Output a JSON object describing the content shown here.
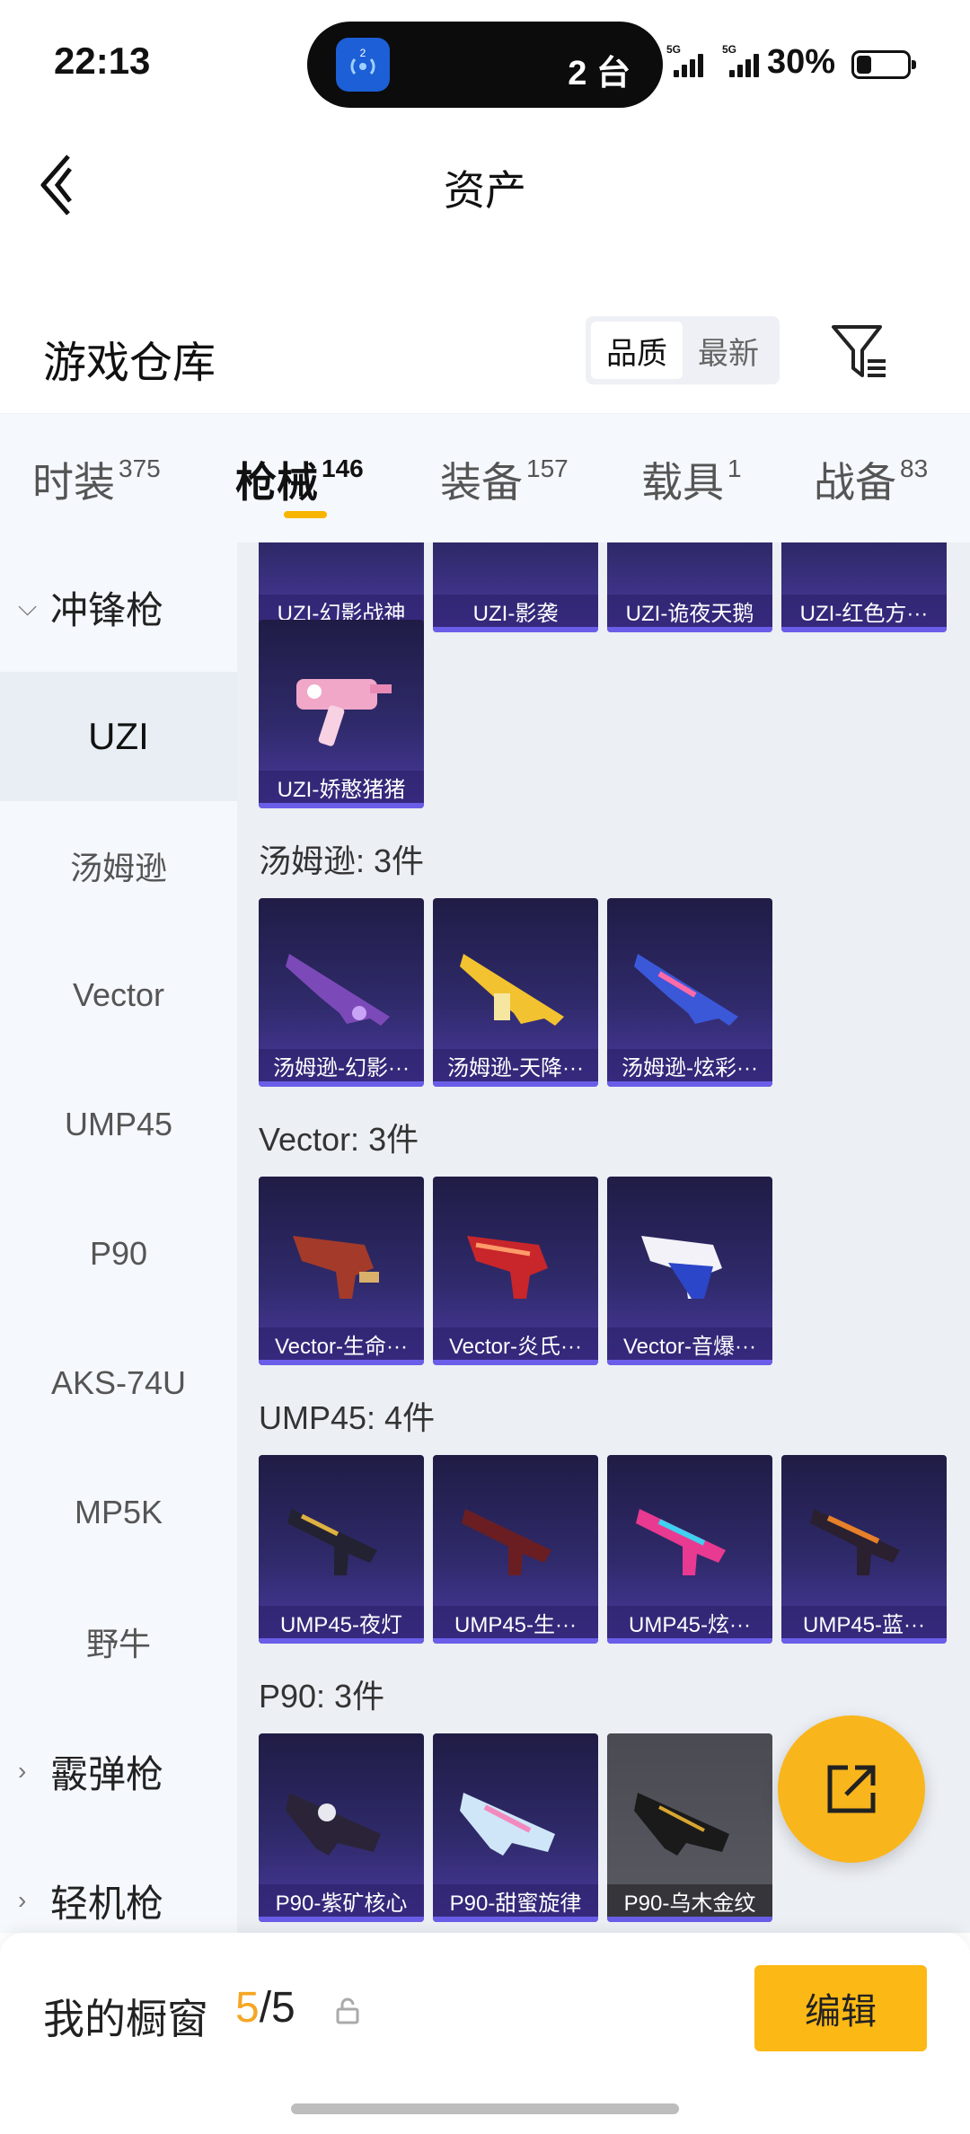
{
  "status_bar": {
    "time": "22:13",
    "island_badge": "2",
    "island_count": "2 台",
    "network1": "5G",
    "network2": "5G",
    "battery": "30%",
    "battery_level": 0.3
  },
  "nav": {
    "title": "资产"
  },
  "repo": {
    "title": "游戏仓库",
    "sort": [
      "品质",
      "最新"
    ],
    "sort_active": "品质"
  },
  "tabs": [
    {
      "label": "时装",
      "count": "375"
    },
    {
      "label": "枪械",
      "count": "146"
    },
    {
      "label": "装备",
      "count": "157"
    },
    {
      "label": "载具",
      "count": "1"
    },
    {
      "label": "战备",
      "count": "83"
    }
  ],
  "sidebar": [
    {
      "label": "冲锋枪",
      "type": "category",
      "expanded": true
    },
    {
      "label": "UZI",
      "type": "item",
      "selected": true
    },
    {
      "label": "汤姆逊",
      "type": "item"
    },
    {
      "label": "Vector",
      "type": "item"
    },
    {
      "label": "UMP45",
      "type": "item"
    },
    {
      "label": "P90",
      "type": "item"
    },
    {
      "label": "AKS-74U",
      "type": "item"
    },
    {
      "label": "MP5K",
      "type": "item"
    },
    {
      "label": "野牛",
      "type": "item"
    },
    {
      "label": "霰弹枪",
      "type": "category"
    },
    {
      "label": "轻机枪",
      "type": "category"
    }
  ],
  "content": {
    "uzi_top_row": [
      "UZI-幻影战神",
      "UZI-影袭",
      "UZI-诡夜天鹅",
      "UZI-红色方···"
    ],
    "uzi_extra": [
      "UZI-娇憨猪猪"
    ],
    "sections": [
      {
        "title": "汤姆逊: 3件",
        "items": [
          "汤姆逊-幻影···",
          "汤姆逊-天降···",
          "汤姆逊-炫彩···"
        ]
      },
      {
        "title": "Vector: 3件",
        "items": [
          "Vector-生命···",
          "Vector-炎氏···",
          "Vector-音爆···"
        ]
      },
      {
        "title": "UMP45: 4件",
        "items": [
          "UMP45-夜灯",
          "UMP45-生···",
          "UMP45-炫···",
          "UMP45-蓝···"
        ]
      },
      {
        "title": "P90: 3件",
        "items": [
          "P90-紫矿核心",
          "P90-甜蜜旋律",
          "P90-乌木金纹"
        ]
      }
    ]
  },
  "showcase": {
    "label": "我的橱窗",
    "current": "5",
    "total": "/5",
    "edit": "编辑"
  },
  "colors": {
    "accent": "#f7b500",
    "card_purple": "#2f2a6a"
  },
  "icons": [
    "back-arrow-icon",
    "filter-icon",
    "lock-icon",
    "share-icon",
    "chevron-down-icon",
    "chevron-right-icon"
  ]
}
